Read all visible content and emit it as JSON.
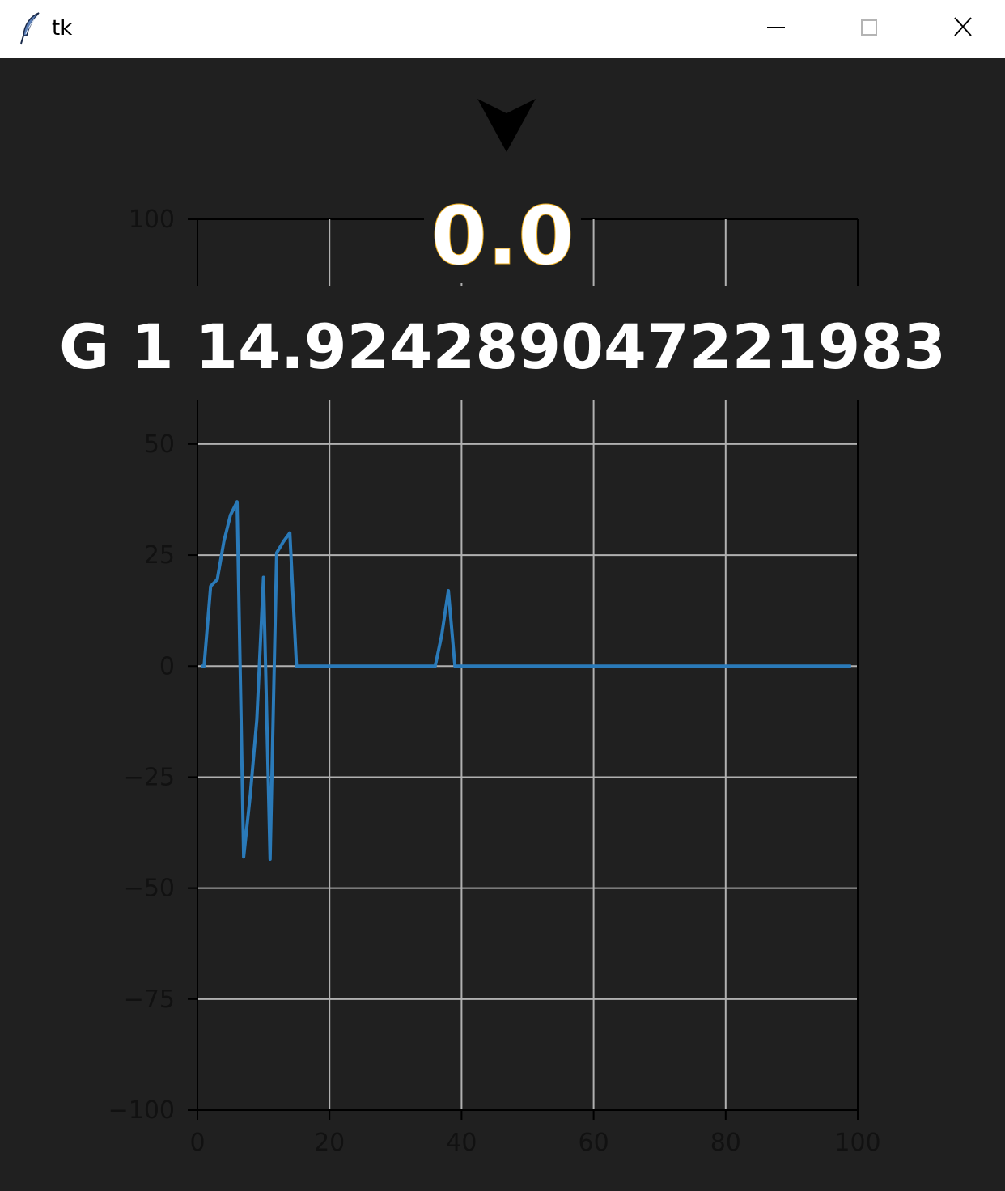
{
  "window": {
    "title": "tk",
    "minimize_icon": "minimize-icon",
    "maximize_icon": "maximize-icon",
    "close_icon": "close-icon"
  },
  "display": {
    "value": "0.0",
    "status": "G 1 14.924289047221983",
    "marker_icon": "down-triangle-icon"
  },
  "colors": {
    "background": "#202020",
    "line": "#2a7ab9",
    "grid": "#b0b0b0",
    "text": "#ffffff"
  },
  "chart_data": [
    {
      "type": "line",
      "title": "",
      "xlabel": "",
      "ylabel": "",
      "xlim": [
        0,
        100
      ],
      "ylim": [
        -100,
        100
      ],
      "xticks": [
        0,
        20,
        40,
        60,
        80,
        100
      ],
      "xtick_labels": [
        "0",
        "20",
        "40",
        "60",
        "80",
        "100"
      ],
      "yticks": [
        100
      ],
      "ytick_labels": [
        "100"
      ],
      "grid": true,
      "series": [
        {
          "x": [],
          "y": []
        }
      ]
    },
    {
      "type": "line",
      "title": "",
      "xlabel": "",
      "ylabel": "",
      "xlim": [
        0,
        100
      ],
      "ylim": [
        -100,
        60
      ],
      "xticks": [
        0,
        20,
        40,
        60,
        80,
        100
      ],
      "xtick_labels": [
        "0",
        "20",
        "40",
        "60",
        "80",
        "100"
      ],
      "yticks": [
        50,
        25,
        0,
        -25,
        -50,
        -75,
        -100
      ],
      "ytick_labels": [
        "50",
        "25",
        "0",
        "−25",
        "−50",
        "−75",
        "−100"
      ],
      "grid": true,
      "series": [
        {
          "x": [
            0.5,
            1,
            2,
            3,
            4,
            5,
            6,
            7,
            8,
            9,
            10,
            11,
            12,
            13,
            14,
            15,
            16,
            20,
            25,
            30,
            35,
            36,
            37,
            38,
            39,
            40,
            50,
            60,
            70,
            80,
            90,
            99
          ],
          "y": [
            0,
            0,
            18,
            19.5,
            28,
            34,
            37,
            -43,
            -29,
            -12,
            20,
            -43.5,
            25.5,
            28,
            30,
            0,
            0,
            0,
            0,
            0,
            0,
            0,
            7,
            17,
            0,
            0,
            0,
            0,
            0,
            0,
            0,
            0
          ]
        }
      ]
    }
  ]
}
